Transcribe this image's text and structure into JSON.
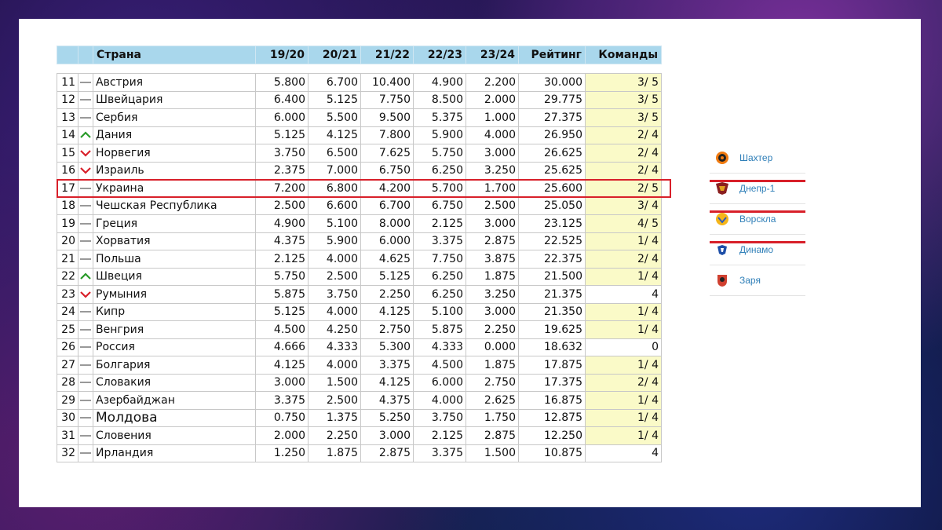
{
  "table": {
    "headers": [
      "",
      "",
      "Страна",
      "19/20",
      "20/21",
      "21/22",
      "22/23",
      "23/24",
      "Рейтинг",
      "Команды"
    ],
    "rows": [
      {
        "pos": "11",
        "trend": "same",
        "country": "Австрия",
        "v1": "5.800",
        "v2": "6.700",
        "v3": "10.400",
        "v4": "4.900",
        "v5": "2.200",
        "rating": "30.000",
        "teams": "3/ 5",
        "teams_hl": true
      },
      {
        "pos": "12",
        "trend": "same",
        "country": "Швейцария",
        "v1": "6.400",
        "v2": "5.125",
        "v3": "7.750",
        "v4": "8.500",
        "v5": "2.000",
        "rating": "29.775",
        "teams": "3/ 5",
        "teams_hl": true
      },
      {
        "pos": "13",
        "trend": "same",
        "country": "Сербия",
        "v1": "6.000",
        "v2": "5.500",
        "v3": "9.500",
        "v4": "5.375",
        "v5": "1.000",
        "rating": "27.375",
        "teams": "3/ 5",
        "teams_hl": true
      },
      {
        "pos": "14",
        "trend": "up",
        "country": "Дания",
        "v1": "5.125",
        "v2": "4.125",
        "v3": "7.800",
        "v4": "5.900",
        "v5": "4.000",
        "rating": "26.950",
        "teams": "2/ 4",
        "teams_hl": true
      },
      {
        "pos": "15",
        "trend": "down",
        "country": "Норвегия",
        "v1": "3.750",
        "v2": "6.500",
        "v3": "7.625",
        "v4": "5.750",
        "v5": "3.000",
        "rating": "26.625",
        "teams": "2/ 4",
        "teams_hl": true
      },
      {
        "pos": "16",
        "trend": "down",
        "country": "Израиль",
        "v1": "2.375",
        "v2": "7.000",
        "v3": "6.750",
        "v4": "6.250",
        "v5": "3.250",
        "rating": "25.625",
        "teams": "2/ 4",
        "teams_hl": true
      },
      {
        "pos": "17",
        "trend": "same",
        "country": "Украина",
        "v1": "7.200",
        "v2": "6.800",
        "v3": "4.200",
        "v4": "5.700",
        "v5": "1.700",
        "rating": "25.600",
        "teams": "2/ 5",
        "teams_hl": true
      },
      {
        "pos": "18",
        "trend": "same",
        "country": "Чешская Республика",
        "v1": "2.500",
        "v2": "6.600",
        "v3": "6.700",
        "v4": "6.750",
        "v5": "2.500",
        "rating": "25.050",
        "teams": "3/ 4",
        "teams_hl": true
      },
      {
        "pos": "19",
        "trend": "same",
        "country": "Греция",
        "v1": "4.900",
        "v2": "5.100",
        "v3": "8.000",
        "v4": "2.125",
        "v5": "3.000",
        "rating": "23.125",
        "teams": "4/ 5",
        "teams_hl": true
      },
      {
        "pos": "20",
        "trend": "same",
        "country": "Хорватия",
        "v1": "4.375",
        "v2": "5.900",
        "v3": "6.000",
        "v4": "3.375",
        "v5": "2.875",
        "rating": "22.525",
        "teams": "1/ 4",
        "teams_hl": true
      },
      {
        "pos": "21",
        "trend": "same",
        "country": "Польша",
        "v1": "2.125",
        "v2": "4.000",
        "v3": "4.625",
        "v4": "7.750",
        "v5": "3.875",
        "rating": "22.375",
        "teams": "2/ 4",
        "teams_hl": true
      },
      {
        "pos": "22",
        "trend": "up",
        "country": "Швеция",
        "v1": "5.750",
        "v2": "2.500",
        "v3": "5.125",
        "v4": "6.250",
        "v5": "1.875",
        "rating": "21.500",
        "teams": "1/ 4",
        "teams_hl": true
      },
      {
        "pos": "23",
        "trend": "down",
        "country": "Румыния",
        "v1": "5.875",
        "v2": "3.750",
        "v3": "2.250",
        "v4": "6.250",
        "v5": "3.250",
        "rating": "21.375",
        "teams": "4",
        "teams_hl": false
      },
      {
        "pos": "24",
        "trend": "same",
        "country": "Кипр",
        "v1": "5.125",
        "v2": "4.000",
        "v3": "4.125",
        "v4": "5.100",
        "v5": "3.000",
        "rating": "21.350",
        "teams": "1/ 4",
        "teams_hl": true
      },
      {
        "pos": "25",
        "trend": "same",
        "country": "Венгрия",
        "v1": "4.500",
        "v2": "4.250",
        "v3": "2.750",
        "v4": "5.875",
        "v5": "2.250",
        "rating": "19.625",
        "teams": "1/ 4",
        "teams_hl": true
      },
      {
        "pos": "26",
        "trend": "same",
        "country": "Россия",
        "v1": "4.666",
        "v2": "4.333",
        "v3": "5.300",
        "v4": "4.333",
        "v5": "0.000",
        "rating": "18.632",
        "teams": "0",
        "teams_hl": false
      },
      {
        "pos": "27",
        "trend": "same",
        "country": "Болгария",
        "v1": "4.125",
        "v2": "4.000",
        "v3": "3.375",
        "v4": "4.500",
        "v5": "1.875",
        "rating": "17.875",
        "teams": "1/ 4",
        "teams_hl": true
      },
      {
        "pos": "28",
        "trend": "same",
        "country": "Словакия",
        "v1": "3.000",
        "v2": "1.500",
        "v3": "4.125",
        "v4": "6.000",
        "v5": "2.750",
        "rating": "17.375",
        "teams": "2/ 4",
        "teams_hl": true
      },
      {
        "pos": "29",
        "trend": "same",
        "country": "Азербайджан",
        "v1": "3.375",
        "v2": "2.500",
        "v3": "4.375",
        "v4": "4.000",
        "v5": "2.625",
        "rating": "16.875",
        "teams": "1/ 4",
        "teams_hl": true
      },
      {
        "pos": "30",
        "trend": "same",
        "country": "Молдова",
        "country_big": true,
        "v1": "0.750",
        "v2": "1.375",
        "v3": "5.250",
        "v4": "3.750",
        "v5": "1.750",
        "rating": "12.875",
        "teams": "1/ 4",
        "teams_hl": true
      },
      {
        "pos": "31",
        "trend": "same",
        "country": "Словения",
        "v1": "2.000",
        "v2": "2.250",
        "v3": "3.000",
        "v4": "2.125",
        "v5": "2.875",
        "rating": "12.250",
        "teams": "1/ 4",
        "teams_hl": true
      },
      {
        "pos": "32",
        "trend": "same",
        "country": "Ирландия",
        "v1": "1.250",
        "v2": "1.875",
        "v3": "2.875",
        "v4": "3.375",
        "v5": "1.500",
        "rating": "10.875",
        "teams": "4",
        "teams_hl": false
      }
    ],
    "highlighted_country": "Украина"
  },
  "colors": {
    "header_bg": "#a9d7ec",
    "teams_highlight_bg": "#fafac8",
    "trend_up": "#2a9a2a",
    "trend_down": "#d8202a",
    "trend_same": "#999999",
    "highlight_border": "#d8202a",
    "club_link": "#2f7fb8"
  },
  "clubs": [
    {
      "name": "Шахтер",
      "icon": "shakhtar-logo-icon",
      "struck": false
    },
    {
      "name": "Днепр-1",
      "icon": "dnipro-logo-icon",
      "struck": true
    },
    {
      "name": "Ворскла",
      "icon": "vorskla-logo-icon",
      "struck": true
    },
    {
      "name": "Динамо",
      "icon": "dynamo-logo-icon",
      "struck": true
    },
    {
      "name": "Заря",
      "icon": "zorya-logo-icon",
      "struck": false
    }
  ]
}
